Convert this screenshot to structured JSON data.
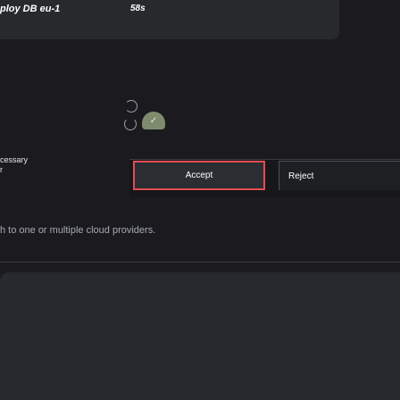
{
  "deploy": {
    "title": "ploy DB eu-1",
    "timer": "58s"
  },
  "overlay": {
    "line1": "cessary",
    "line2": "r"
  },
  "popup": {
    "accept_label": "Accept",
    "reject_label": "Reject"
  },
  "badge": {
    "check": "✓"
  },
  "content": {
    "cloud_text": "h to one or multiple cloud providers."
  },
  "colors": {
    "accent_red": "#e24d53",
    "approve_green": "#7f8b6e",
    "background": "#1b1b1f"
  }
}
